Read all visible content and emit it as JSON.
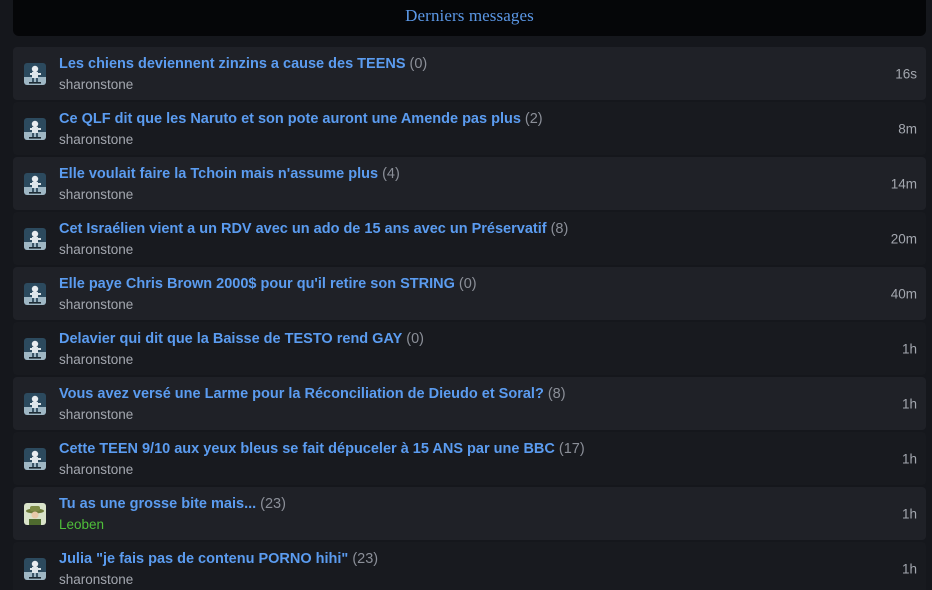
{
  "header": {
    "title": "Derniers messages"
  },
  "topics": [
    {
      "title": "Les chiens deviennent zinzins a cause des TEENS",
      "count": "(0)",
      "author": "sharonstone",
      "time": "16s",
      "avatar": "skater-avatar-icon"
    },
    {
      "title": "Ce QLF dit que les Naruto et son pote auront une Amende pas plus",
      "count": "(2)",
      "author": "sharonstone",
      "time": "8m",
      "avatar": "skater-avatar-icon"
    },
    {
      "title": "Elle voulait faire la Tchoin mais n'assume plus",
      "count": "(4)",
      "author": "sharonstone",
      "time": "14m",
      "avatar": "skater-avatar-icon"
    },
    {
      "title": "Cet Israélien vient a un RDV avec un ado de 15 ans avec un Préservatif",
      "count": "(8)",
      "author": "sharonstone",
      "time": "20m",
      "avatar": "skater-avatar-icon"
    },
    {
      "title": "Elle paye Chris Brown 2000$ pour qu'il retire son STRING",
      "count": "(0)",
      "author": "sharonstone",
      "time": "40m",
      "avatar": "skater-avatar-icon"
    },
    {
      "title": "Delavier qui dit que la Baisse de TESTO rend GAY",
      "count": "(0)",
      "author": "sharonstone",
      "time": "1h",
      "avatar": "skater-avatar-icon"
    },
    {
      "title": "Vous avez versé une Larme pour la Réconciliation de Dieudo et Soral?",
      "count": "(8)",
      "author": "sharonstone",
      "time": "1h",
      "avatar": "skater-avatar-icon"
    },
    {
      "title": "Cette TEEN 9/10 aux yeux bleus se fait dépuceler à 15 ANS par une BBC",
      "count": "(17)",
      "author": "sharonstone",
      "time": "1h",
      "avatar": "skater-avatar-icon"
    },
    {
      "title": "Tu as une grosse bite mais...",
      "count": "(23)",
      "author": "Leoben",
      "time": "1h",
      "avatar": "hat-avatar-icon"
    },
    {
      "title": "Julia \"je fais pas de contenu PORNO hihi\"",
      "count": "(23)",
      "author": "sharonstone",
      "time": "1h",
      "avatar": "skater-avatar-icon"
    }
  ],
  "colors": {
    "link": "#5b9cf0",
    "author": "#a3a7af",
    "author_highlight": "#4fbf3a",
    "row_odd": "#1f2127",
    "row_even": "#181a1f"
  }
}
